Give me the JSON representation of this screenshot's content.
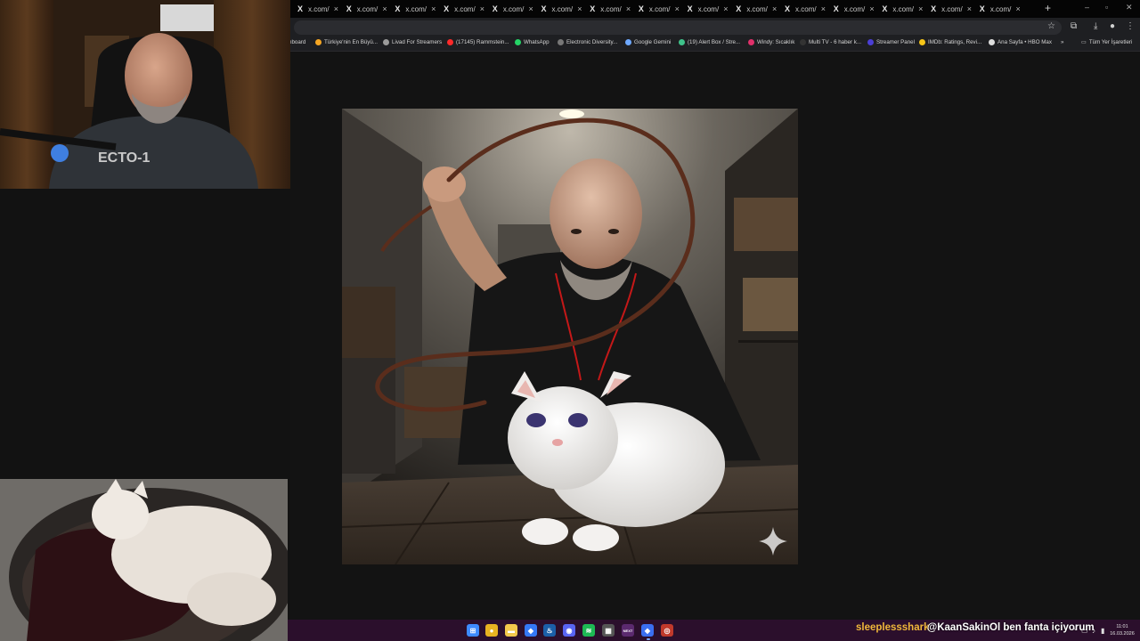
{
  "browser": {
    "tabs": [
      {
        "label": "x.com/"
      },
      {
        "label": "x.com/"
      },
      {
        "label": "x.com/"
      },
      {
        "label": "x.com/"
      },
      {
        "label": "x.com/"
      },
      {
        "label": "x.com/"
      },
      {
        "label": "x.com/"
      },
      {
        "label": "x.com/"
      },
      {
        "label": "x.com/"
      },
      {
        "label": "x.com/"
      },
      {
        "label": "x.com/"
      },
      {
        "label": "x.com/"
      },
      {
        "label": "x.com/"
      },
      {
        "label": "x.com/"
      },
      {
        "label": "x.com/"
      }
    ],
    "new_tab": "+",
    "window_controls": {
      "minimize": "–",
      "maximize": "▫",
      "close": "✕"
    },
    "toolbar_icons": {
      "star": "☆",
      "extensions": "⧉",
      "download": "⤓",
      "profile": "●",
      "menu": "⋮"
    },
    "bookmarks": [
      {
        "label": "hboard",
        "color": "#444"
      },
      {
        "label": "Türkiye'nin En Büyü...",
        "color": "#f5a623"
      },
      {
        "label": "Livad For Streamers",
        "color": "#9b9b9b"
      },
      {
        "label": "(17145) Rammstein...",
        "color": "#ff2a2a"
      },
      {
        "label": "WhatsApp",
        "color": "#25d366"
      },
      {
        "label": "Electronic Diversity...",
        "color": "#777"
      },
      {
        "label": "Google Gemini",
        "color": "#6ea8ff"
      },
      {
        "label": "(19) Alert Box / Stre...",
        "color": "#3fc28a"
      },
      {
        "label": "Windy: Sıcaklık",
        "color": "#e0306a"
      },
      {
        "label": "Multi TV - 6 haber k...",
        "color": "#333"
      },
      {
        "label": "Streamer Panel",
        "color": "#4b3fd6"
      },
      {
        "label": "IMDb: Ratings, Revi...",
        "color": "#f5c518"
      },
      {
        "label": "Ana Sayfa • HBO Max",
        "color": "#dddddd"
      }
    ],
    "bookmarks_more": "»",
    "all_bookmarks": "Tüm Yer İşaretleri"
  },
  "taskbar": {
    "apps": [
      {
        "name": "start",
        "glyph": "⊞",
        "color": "#3d8bff"
      },
      {
        "name": "chrome",
        "glyph": "●",
        "color": "#e8b321"
      },
      {
        "name": "file-explorer",
        "glyph": "▬",
        "color": "#f2c94c"
      },
      {
        "name": "app-blue",
        "glyph": "◆",
        "color": "#3478f6"
      },
      {
        "name": "steam",
        "glyph": "♨",
        "color": "#1b5fa8"
      },
      {
        "name": "discord",
        "glyph": "◉",
        "color": "#5865f2"
      },
      {
        "name": "spotify",
        "glyph": "≋",
        "color": "#1db954"
      },
      {
        "name": "calculator",
        "glyph": "▦",
        "color": "#555"
      },
      {
        "name": "next",
        "glyph": "NEXT",
        "color": "#5b2a6e"
      },
      {
        "name": "app-active",
        "glyph": "◆",
        "color": "#3a6ff0"
      },
      {
        "name": "obs",
        "glyph": "◎",
        "color": "#c0392b"
      }
    ],
    "tray_icons": {
      "chevron": "^",
      "network": "▭",
      "volume": "♪",
      "battery": "▮"
    },
    "time": "11:01",
    "date": "16.03.2026"
  },
  "chat_overlay": {
    "username": "sleeplessshark",
    "message": "@KaanSakinOl ben fanta içiyorum"
  },
  "generated_image": {
    "watermark": "gemini-sparkle-icon"
  }
}
